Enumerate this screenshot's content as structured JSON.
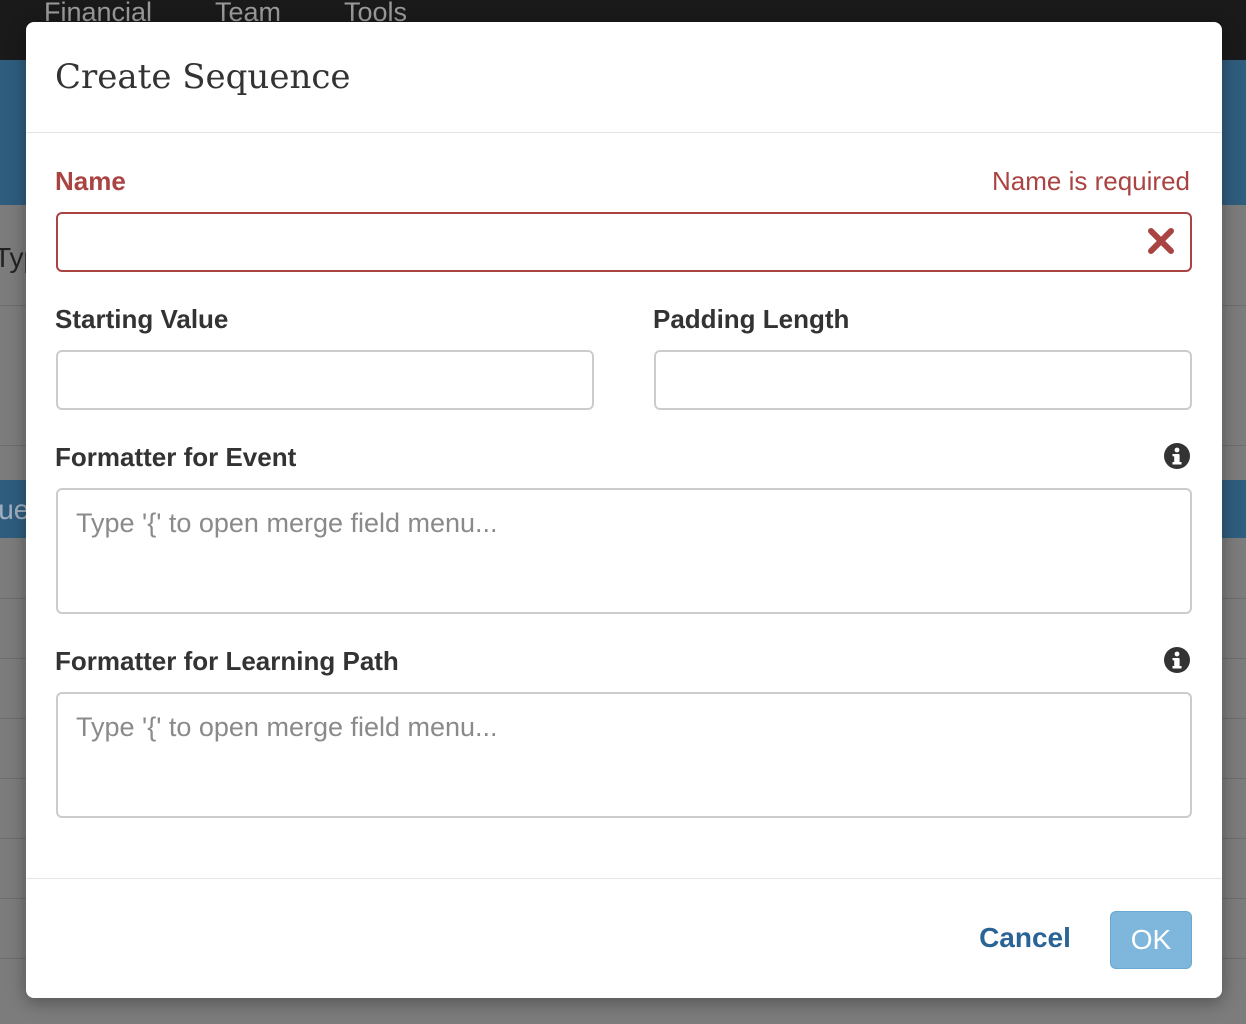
{
  "background": {
    "nav_items": [
      "Financial",
      "Team",
      "Tools"
    ],
    "fragment_type": "Typ",
    "fragment_value": "lue"
  },
  "dialog": {
    "title": "Create Sequence",
    "name": {
      "label": "Name",
      "error": "Name is required",
      "value": "",
      "clear_icon": "times-icon"
    },
    "starting_value": {
      "label": "Starting Value",
      "value": ""
    },
    "padding_length": {
      "label": "Padding Length",
      "value": ""
    },
    "formatter_event": {
      "label": "Formatter for Event",
      "placeholder": "Type '{' to open merge field menu...",
      "info_icon": "info-circle-icon"
    },
    "formatter_learning_path": {
      "label": "Formatter for Learning Path",
      "placeholder": "Type '{' to open merge field menu...",
      "info_icon": "info-circle-icon"
    },
    "footer": {
      "cancel_label": "Cancel",
      "ok_label": "OK"
    }
  },
  "colors": {
    "error": "#a94442",
    "link": "#2a6496",
    "primary_disabled": "#7fb6dc"
  }
}
